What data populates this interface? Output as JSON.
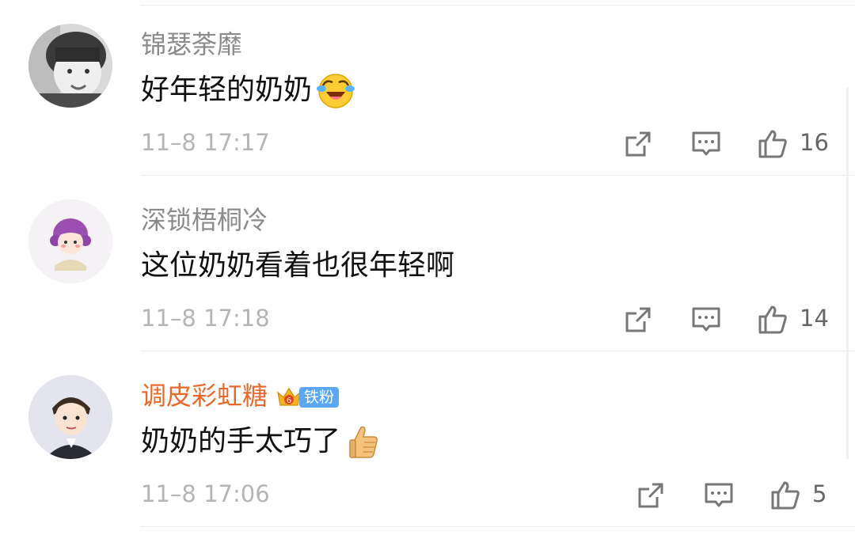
{
  "comments": [
    {
      "username": "锦瑟荼靡",
      "text": "好年轻的奶奶",
      "emoji": "crying-laughing-emoji",
      "timestamp": "11–8 17:17",
      "likes": "16",
      "vip": false
    },
    {
      "username": "深锁梧桐冷",
      "text": "这位奶奶看着也很年轻啊",
      "emoji": "",
      "timestamp": "11–8 17:18",
      "likes": "14",
      "vip": false
    },
    {
      "username": "调皮彩虹糖",
      "text": "奶奶的手太巧了",
      "emoji": "thumbs-up-emoji",
      "timestamp": "11–8 17:06",
      "likes": "5",
      "vip": true,
      "badge_level": "6",
      "badge_label": "铁粉"
    }
  ],
  "colors": {
    "username": "#8a8a8a",
    "vip_username": "#e8692b",
    "text": "#111111",
    "meta": "#b5b5b5",
    "badge": "#5aa8f5"
  },
  "icons": [
    "share-icon",
    "reply-icon",
    "like-icon"
  ]
}
